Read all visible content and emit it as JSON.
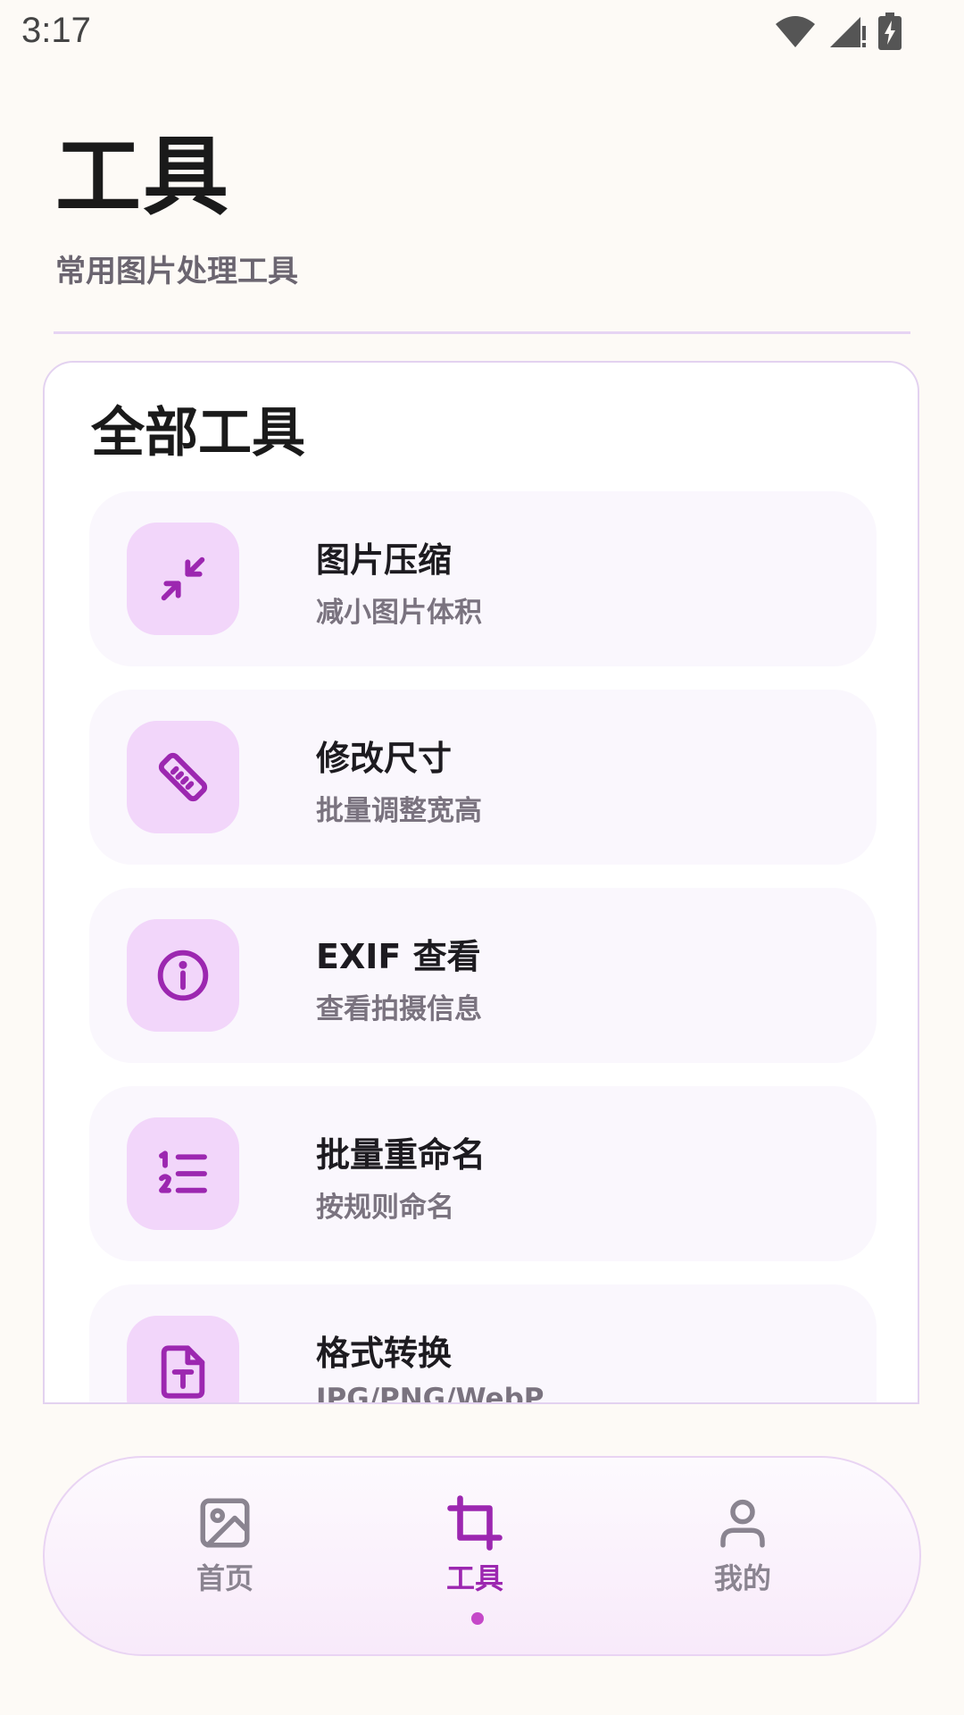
{
  "status_bar": {
    "time": "3:17"
  },
  "header": {
    "title": "工具",
    "subtitle": "常用图片处理工具"
  },
  "panel": {
    "title": "全部工具",
    "tools": [
      {
        "name": "图片压缩",
        "desc": "减小图片体积",
        "icon": "compress-icon"
      },
      {
        "name": "修改尺寸",
        "desc": "批量调整宽高",
        "icon": "ruler-icon"
      },
      {
        "name": "EXIF 查看",
        "desc": "查看拍摄信息",
        "icon": "info-icon"
      },
      {
        "name": "批量重命名",
        "desc": "按规则命名",
        "icon": "numbered-list-icon"
      },
      {
        "name": "格式转换",
        "desc": "JPG/PNG/WebP",
        "icon": "file-text-icon"
      }
    ]
  },
  "bottom_nav": {
    "items": [
      {
        "label": "首页",
        "icon": "image-icon",
        "active": false
      },
      {
        "label": "工具",
        "icon": "crop-icon",
        "active": true
      },
      {
        "label": "我的",
        "icon": "person-icon",
        "active": false
      }
    ]
  },
  "colors": {
    "accent": "#9c27b0",
    "icon_tile": "#f2d6fa",
    "background": "#fdfaf6",
    "card": "#faf7fd"
  }
}
